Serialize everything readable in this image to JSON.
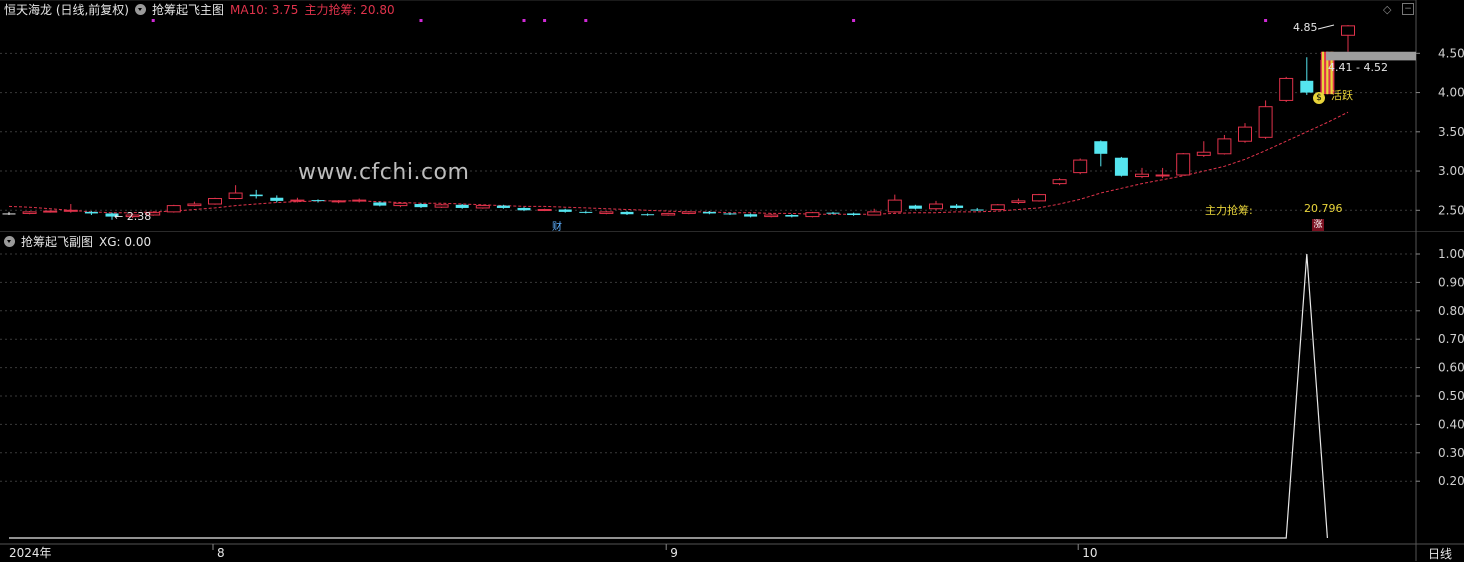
{
  "main_header": {
    "stock": "恒天海龙 (日线,前复权)",
    "indicator": "抢筹起飞主图",
    "ma10": "MA10: 3.75",
    "zhuli": "主力抢筹: 20.80"
  },
  "sub_header": {
    "indicator": "抢筹起飞副图",
    "xg": "XG: 0.00"
  },
  "watermark": "www.cfchi.com",
  "annotations": {
    "high_label": "4.85",
    "low_label": "← 2.38",
    "range_label": "4.41 - 4.52",
    "active_label": "活跃",
    "zhuli_label": "主力抢筹:",
    "zhuli_value": "20.796",
    "cai_tag": "财",
    "zhang_tag": "涨"
  },
  "x_axis": [
    "2024年",
    "8",
    "9",
    "10"
  ],
  "period_label": "日线",
  "colors": {
    "up": "#e0334b",
    "down": "#55e5ef",
    "ma": "#e0334b",
    "accent_yellow": "#e8d43a",
    "magenta": "#d02ad6"
  },
  "chart_data": [
    {
      "type": "candlestick",
      "title": "恒天海龙 (日线,前复权)",
      "ylim": [
        2.3,
        4.95
      ],
      "y_ticks": [
        "4.50",
        "4.00",
        "3.50",
        "3.00",
        "2.50"
      ],
      "ma10_last": 3.75,
      "candles": [
        [
          2.46,
          2.46,
          2.48,
          2.44
        ],
        [
          2.46,
          2.48,
          2.49,
          2.45
        ],
        [
          2.48,
          2.49,
          2.5,
          2.47
        ],
        [
          2.49,
          2.5,
          2.58,
          2.47
        ],
        [
          2.48,
          2.46,
          2.49,
          2.44
        ],
        [
          2.46,
          2.42,
          2.47,
          2.38
        ],
        [
          2.42,
          2.44,
          2.46,
          2.4
        ],
        [
          2.44,
          2.47,
          2.49,
          2.43
        ],
        [
          2.48,
          2.56,
          2.57,
          2.47
        ],
        [
          2.56,
          2.58,
          2.61,
          2.55
        ],
        [
          2.58,
          2.65,
          2.66,
          2.57
        ],
        [
          2.65,
          2.72,
          2.82,
          2.64
        ],
        [
          2.7,
          2.68,
          2.76,
          2.65
        ],
        [
          2.66,
          2.62,
          2.69,
          2.6
        ],
        [
          2.62,
          2.63,
          2.66,
          2.6
        ],
        [
          2.63,
          2.62,
          2.64,
          2.6
        ],
        [
          2.61,
          2.62,
          2.63,
          2.59
        ],
        [
          2.62,
          2.63,
          2.65,
          2.6
        ],
        [
          2.6,
          2.56,
          2.61,
          2.55
        ],
        [
          2.56,
          2.59,
          2.6,
          2.54
        ],
        [
          2.58,
          2.54,
          2.59,
          2.53
        ],
        [
          2.54,
          2.57,
          2.58,
          2.53
        ],
        [
          2.57,
          2.53,
          2.58,
          2.52
        ],
        [
          2.53,
          2.56,
          2.57,
          2.52
        ],
        [
          2.56,
          2.53,
          2.57,
          2.52
        ],
        [
          2.53,
          2.5,
          2.54,
          2.49
        ],
        [
          2.5,
          2.51,
          2.52,
          2.49
        ],
        [
          2.51,
          2.48,
          2.52,
          2.47
        ],
        [
          2.48,
          2.47,
          2.49,
          2.46
        ],
        [
          2.46,
          2.48,
          2.49,
          2.45
        ],
        [
          2.48,
          2.45,
          2.49,
          2.44
        ],
        [
          2.45,
          2.44,
          2.46,
          2.43
        ],
        [
          2.44,
          2.46,
          2.47,
          2.43
        ],
        [
          2.46,
          2.48,
          2.49,
          2.45
        ],
        [
          2.48,
          2.46,
          2.49,
          2.45
        ],
        [
          2.46,
          2.45,
          2.47,
          2.44
        ],
        [
          2.45,
          2.42,
          2.46,
          2.41
        ],
        [
          2.42,
          2.44,
          2.46,
          2.41
        ],
        [
          2.44,
          2.42,
          2.45,
          2.41
        ],
        [
          2.42,
          2.47,
          2.48,
          2.41
        ],
        [
          2.47,
          2.46,
          2.48,
          2.45
        ],
        [
          2.46,
          2.44,
          2.47,
          2.43
        ],
        [
          2.44,
          2.48,
          2.52,
          2.44
        ],
        [
          2.48,
          2.63,
          2.7,
          2.47
        ],
        [
          2.56,
          2.52,
          2.57,
          2.51
        ],
        [
          2.52,
          2.58,
          2.62,
          2.5
        ],
        [
          2.56,
          2.53,
          2.58,
          2.52
        ],
        [
          2.51,
          2.5,
          2.53,
          2.49
        ],
        [
          2.51,
          2.57,
          2.58,
          2.5
        ],
        [
          2.6,
          2.62,
          2.65,
          2.58
        ],
        [
          2.62,
          2.7,
          2.71,
          2.61
        ],
        [
          2.84,
          2.89,
          2.91,
          2.82
        ],
        [
          2.98,
          3.14,
          3.16,
          2.96
        ],
        [
          3.38,
          3.22,
          3.39,
          3.06
        ],
        [
          3.17,
          2.94,
          3.18,
          2.93
        ],
        [
          2.93,
          2.96,
          3.04,
          2.91
        ],
        [
          2.94,
          2.95,
          3.04,
          2.91
        ],
        [
          2.95,
          3.22,
          3.23,
          2.94
        ],
        [
          3.2,
          3.24,
          3.38,
          3.18
        ],
        [
          3.22,
          3.41,
          3.46,
          3.21
        ],
        [
          3.38,
          3.56,
          3.61,
          3.36
        ],
        [
          3.43,
          3.82,
          3.9,
          3.41
        ],
        [
          3.9,
          4.18,
          4.2,
          3.88
        ],
        [
          4.15,
          4.0,
          4.45,
          3.97
        ],
        [
          4.0,
          4.41,
          4.42,
          3.98
        ],
        [
          4.73,
          4.85,
          4.86,
          4.52
        ]
      ],
      "ma10": [
        2.55,
        2.54,
        2.52,
        2.5,
        2.48,
        2.47,
        2.47,
        2.48,
        2.49,
        2.51,
        2.53,
        2.56,
        2.58,
        2.6,
        2.61,
        2.62,
        2.62,
        2.62,
        2.61,
        2.6,
        2.59,
        2.59,
        2.58,
        2.57,
        2.56,
        2.55,
        2.55,
        2.54,
        2.53,
        2.52,
        2.51,
        2.5,
        2.49,
        2.48,
        2.48,
        2.47,
        2.47,
        2.46,
        2.46,
        2.45,
        2.45,
        2.45,
        2.45,
        2.46,
        2.47,
        2.47,
        2.48,
        2.48,
        2.49,
        2.51,
        2.53,
        2.58,
        2.64,
        2.72,
        2.78,
        2.84,
        2.89,
        2.94,
        3.0,
        3.06,
        3.15,
        3.26,
        3.38,
        3.5,
        3.62,
        3.75
      ],
      "signal_dots": [
        7,
        20,
        25,
        26,
        28,
        41,
        61
      ]
    },
    {
      "type": "line",
      "title": "抢筹起飞副图",
      "ylim": [
        0,
        1
      ],
      "y_ticks": [
        "1.00",
        "0.90",
        "0.80",
        "0.70",
        "0.60",
        "0.50",
        "0.40",
        "0.30",
        "0.20"
      ],
      "series": [
        {
          "name": "XG",
          "values": [
            0,
            0,
            0,
            0,
            0,
            0,
            0,
            0,
            0,
            0,
            0,
            0,
            0,
            0,
            0,
            0,
            0,
            0,
            0,
            0,
            0,
            0,
            0,
            0,
            0,
            0,
            0,
            0,
            0,
            0,
            0,
            0,
            0,
            0,
            0,
            0,
            0,
            0,
            0,
            0,
            0,
            0,
            0,
            0,
            0,
            0,
            0,
            0,
            0,
            0,
            0,
            0,
            0,
            0,
            0,
            0,
            0,
            0,
            0,
            0,
            0,
            0,
            0,
            1,
            0
          ]
        }
      ]
    }
  ]
}
